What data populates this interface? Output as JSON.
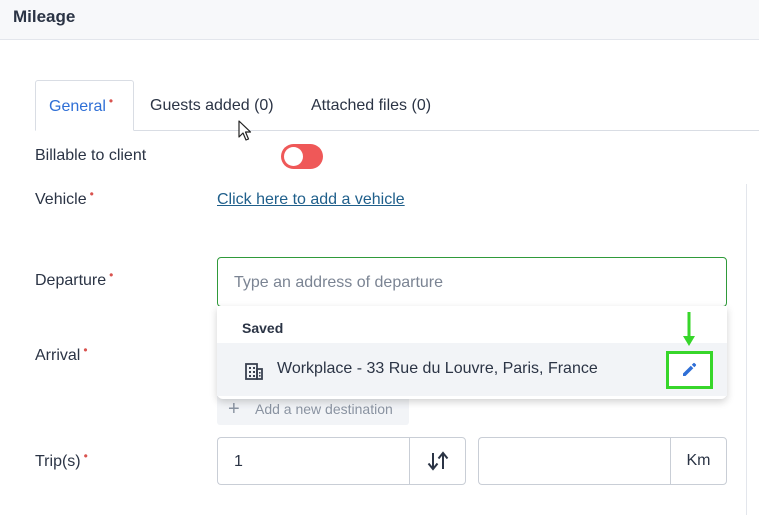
{
  "header": {
    "title": "Mileage"
  },
  "tabs": [
    {
      "label": "General",
      "required": "•",
      "active": true
    },
    {
      "label": "Guests added (0)"
    },
    {
      "label": "Attached files (0)"
    }
  ],
  "form": {
    "billable": {
      "label": "Billable to client",
      "value": false,
      "toggle_color": "#ef5858"
    },
    "vehicle": {
      "label": "Vehicle",
      "required": "•",
      "link_text": "Click here to add a vehicle"
    },
    "departure": {
      "label": "Departure",
      "required": "•",
      "placeholder": "Type an address of departure",
      "value": ""
    },
    "arrival": {
      "label": "Arrival",
      "required": "•"
    },
    "trips": {
      "label": "Trip(s)",
      "required": "•",
      "value": "1"
    },
    "distance": {
      "value": "",
      "unit": "Km"
    }
  },
  "dropdown": {
    "section_label": "Saved",
    "items": [
      {
        "icon": "building-icon",
        "text": "Workplace - 33 Rue du Louvre, Paris, France",
        "action_icon": "pencil-icon"
      }
    ]
  },
  "add_destination": {
    "icon": "plus-icon",
    "label": "Add a new destination"
  },
  "colors": {
    "accent": "#2f6fd6",
    "required": "#d9534f",
    "focus_border": "#2f9a3a",
    "highlight": "#37d62a"
  }
}
